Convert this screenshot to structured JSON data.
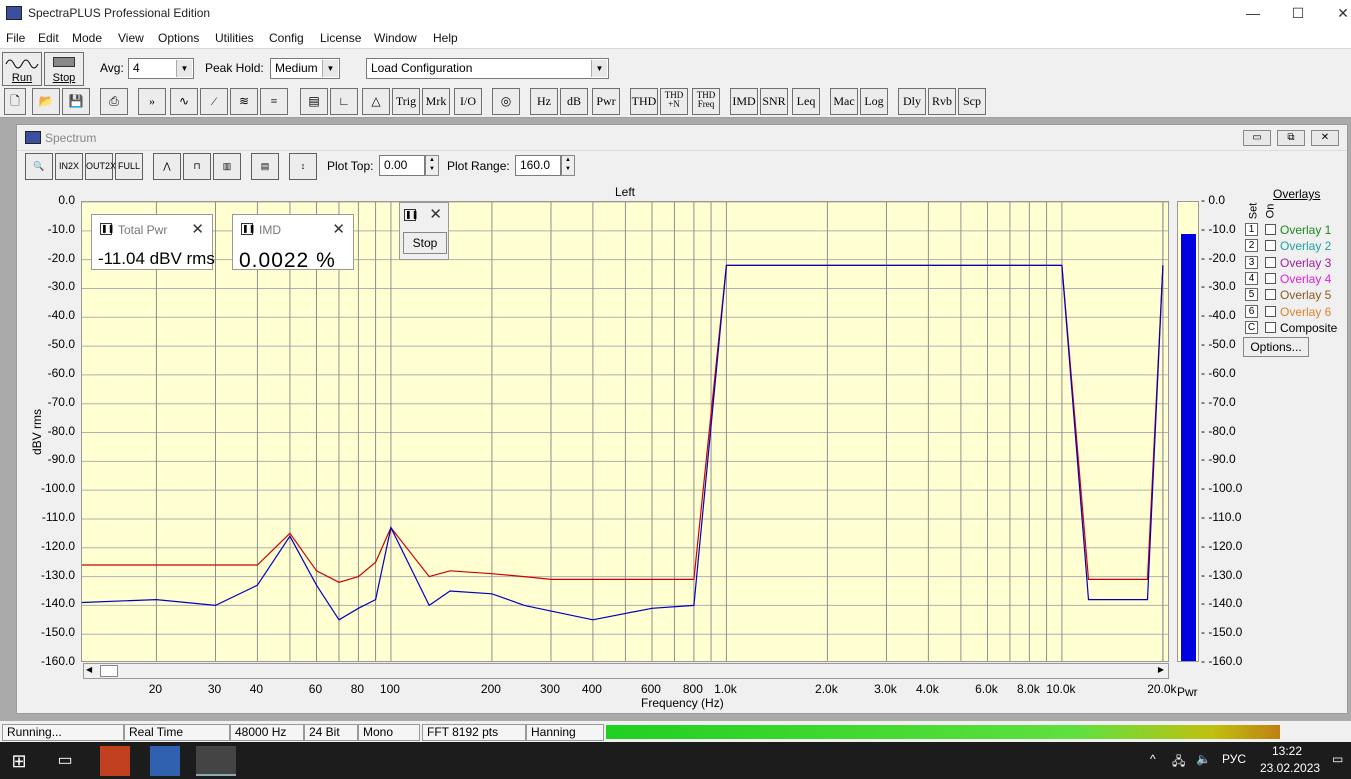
{
  "app": {
    "title": "SpectraPLUS Professional Edition",
    "min": "—",
    "max": "☐",
    "close": "✕"
  },
  "menu": [
    "File",
    "Edit",
    "Mode",
    "View",
    "Options",
    "Utilities",
    "Config",
    "License",
    "Window",
    "Help"
  ],
  "toolbar1": {
    "run_label": "Run",
    "stop_label": "Stop",
    "avg_label": "Avg:",
    "avg_value": "4",
    "peak_label": "Peak Hold:",
    "peak_value": "Medium",
    "config_value": "Load Configuration"
  },
  "toolbar2": [
    "Trig",
    "Mrk",
    "I/O",
    "Hz",
    "dB",
    "Pwr",
    "THD",
    "THD +N",
    "THD Freq",
    "IMD",
    "SNR",
    "Leq",
    "Mac",
    "Log",
    "Dly",
    "Rvb",
    "Scp"
  ],
  "spectrum": {
    "title": "Spectrum",
    "plot_top_label": "Plot Top:",
    "plot_top_value": "0.00",
    "plot_range_label": "Plot Range:",
    "plot_range_value": "160.0",
    "channel_label": "Left",
    "ylabel": "dBV rms",
    "xlabel": "Frequency (Hz)",
    "yticks": [
      "0.0",
      "-10.0",
      "-20.0",
      "-30.0",
      "-40.0",
      "-50.0",
      "-60.0",
      "-70.0",
      "-80.0",
      "-90.0",
      "-100.0",
      "-110.0",
      "-120.0",
      "-130.0",
      "-140.0",
      "-150.0",
      "-160.0"
    ],
    "xticks": [
      "20",
      "30",
      "40",
      "60",
      "80",
      "100",
      "200",
      "300",
      "400",
      "600",
      "800",
      "1.0k",
      "2.0k",
      "3.0k",
      "4.0k",
      "6.0k",
      "8.0k",
      "10.0k",
      "20.0k"
    ],
    "pwr_label": "Pwr",
    "pwr_yticks": [
      "0.0",
      "-10.0",
      "-20.0",
      "-30.0",
      "-40.0",
      "-50.0",
      "-60.0",
      "-70.0",
      "-80.0",
      "-90.0",
      "-100.0",
      "-110.0",
      "-120.0",
      "-130.0",
      "-140.0",
      "-150.0",
      "-160.0"
    ]
  },
  "meters": {
    "total_pwr": {
      "label": "Total Pwr",
      "value": "-11.04 dBV rms"
    },
    "imd": {
      "label": "IMD",
      "value": "0.0022 %"
    },
    "stop_label": "Stop"
  },
  "overlays": {
    "title": "Overlays",
    "set_label": "Set",
    "on_label": "On",
    "items": [
      {
        "num": "1",
        "name": "Overlay 1",
        "color": "#1a8a1a"
      },
      {
        "num": "2",
        "name": "Overlay 2",
        "color": "#20a0a0"
      },
      {
        "num": "3",
        "name": "Overlay 3",
        "color": "#a020a0"
      },
      {
        "num": "4",
        "name": "Overlay 4",
        "color": "#e020e0"
      },
      {
        "num": "5",
        "name": "Overlay 5",
        "color": "#8a5a20"
      },
      {
        "num": "6",
        "name": "Overlay 6",
        "color": "#e08030"
      },
      {
        "num": "C",
        "name": "Composite",
        "color": "#000000"
      }
    ],
    "options_label": "Options..."
  },
  "status": {
    "state": "Running...",
    "mode": "Real Time",
    "rate": "48000 Hz",
    "bits": "24 Bit",
    "channels": "Mono",
    "fft": "FFT 8192 pts",
    "window": "Hanning"
  },
  "tray": {
    "lang": "РУС",
    "time": "13:22",
    "date": "23.02.2023"
  },
  "chart_data": {
    "type": "line",
    "xscale": "log",
    "xlim": [
      12,
      21000
    ],
    "ylim": [
      -160,
      0
    ],
    "ylabel": "dBV rms",
    "xlabel": "Frequency (Hz)",
    "grid": true,
    "series": [
      {
        "color": "#d00000",
        "x": [
          12,
          20,
          30,
          40,
          50,
          60,
          70,
          80,
          90,
          100,
          130,
          150,
          200,
          250,
          300,
          400,
          600,
          800,
          1000,
          2000,
          3000,
          4000,
          5000,
          6000,
          7000,
          8000,
          9000,
          10000,
          12000,
          15000,
          18000,
          20000
        ],
        "y": [
          -126,
          -126,
          -126,
          -126,
          -115,
          -128,
          -132,
          -130,
          -125,
          -113,
          -130,
          -128,
          -129,
          -130,
          -131,
          -131,
          -131,
          -131,
          -22,
          -22,
          -22,
          -22,
          -22,
          -22,
          -22,
          -22,
          -22,
          -22,
          -131,
          -131,
          -131,
          -22
        ]
      },
      {
        "color": "#0000c0",
        "x": [
          12,
          20,
          30,
          40,
          50,
          60,
          70,
          80,
          90,
          100,
          130,
          150,
          200,
          250,
          300,
          400,
          600,
          800,
          1000,
          2000,
          3000,
          4000,
          5000,
          6000,
          7000,
          8000,
          9000,
          10000,
          12000,
          15000,
          18000,
          20000
        ],
        "y": [
          -139,
          -138,
          -140,
          -133,
          -116,
          -133,
          -145,
          -141,
          -138,
          -113,
          -140,
          -135,
          -136,
          -140,
          -142,
          -145,
          -141,
          -140,
          -22,
          -22,
          -22,
          -22,
          -22,
          -22,
          -22,
          -22,
          -22,
          -22,
          -138,
          -138,
          -138,
          -22
        ]
      }
    ],
    "pwr_bar_db": -11.04
  }
}
